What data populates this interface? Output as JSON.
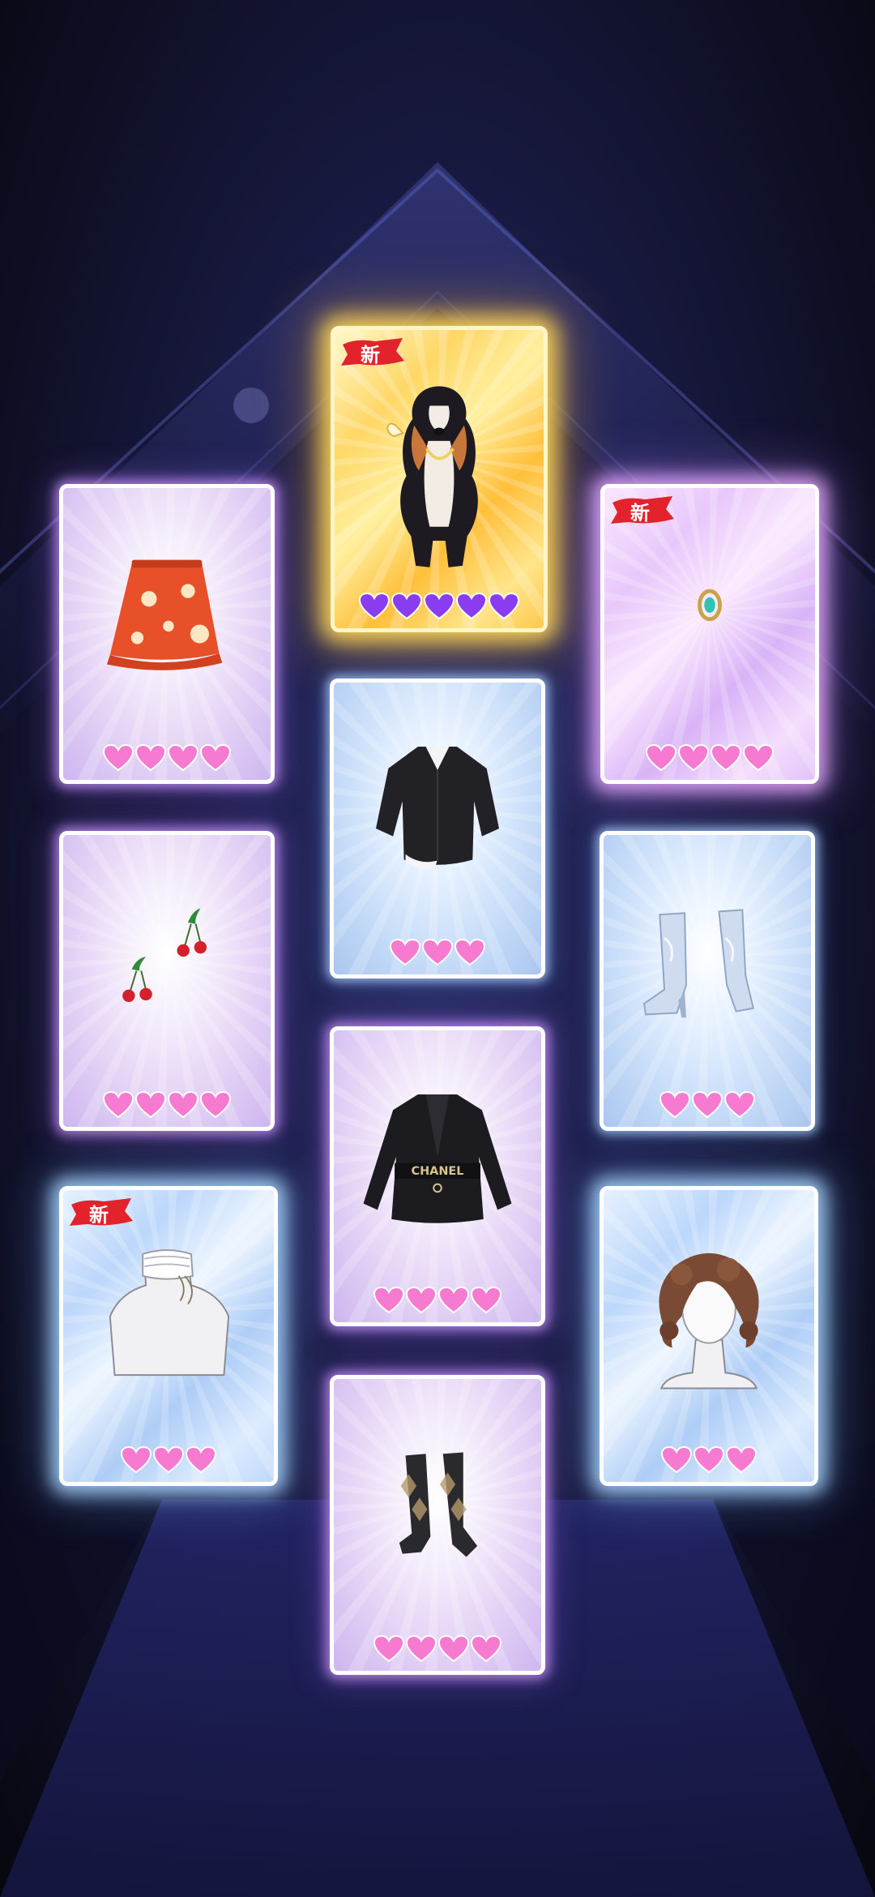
{
  "colors": {
    "heart_pink": "#f57ad0",
    "heart_purple": "#8a3cf0",
    "badge_red": "#e2232c",
    "background": "#1a1b45"
  },
  "new_badge_label": "新",
  "cards": [
    {
      "id": "dog-pet",
      "item_icon": "dog-pet-icon",
      "frame": "gold",
      "rarity": 5,
      "heart_color": "purple",
      "is_new": true
    },
    {
      "id": "floral-skirt",
      "item_icon": "orange-floral-skirt-icon",
      "frame": "pink",
      "rarity": 4,
      "heart_color": "pink",
      "is_new": false
    },
    {
      "id": "gem-ring",
      "item_icon": "gem-ring-icon",
      "frame": "crystal-pink",
      "rarity": 4,
      "heart_color": "pink",
      "is_new": true
    },
    {
      "id": "black-shirt",
      "item_icon": "black-shirt-icon",
      "frame": "blue",
      "rarity": 3,
      "heart_color": "pink",
      "is_new": false
    },
    {
      "id": "cherry-earrings",
      "item_icon": "cherry-earrings-icon",
      "frame": "pink",
      "rarity": 4,
      "heart_color": "pink",
      "is_new": false
    },
    {
      "id": "silver-boots",
      "item_icon": "silver-boots-icon",
      "frame": "blue",
      "rarity": 3,
      "heart_color": "pink",
      "is_new": false
    },
    {
      "id": "black-jacket",
      "item_icon": "black-belted-jacket-icon",
      "frame": "pink",
      "rarity": 4,
      "heart_color": "pink",
      "is_new": false,
      "print_text": "CHANEL"
    },
    {
      "id": "lace-choker",
      "item_icon": "lace-choker-icon",
      "frame": "crystal-blue",
      "rarity": 3,
      "heart_color": "pink",
      "is_new": true
    },
    {
      "id": "curly-hair",
      "item_icon": "curly-hair-icon",
      "frame": "crystal-blue",
      "rarity": 3,
      "heart_color": "pink",
      "is_new": false
    },
    {
      "id": "argyle-socks",
      "item_icon": "argyle-socks-icon",
      "frame": "pink",
      "rarity": 4,
      "heart_color": "pink",
      "is_new": false
    }
  ]
}
